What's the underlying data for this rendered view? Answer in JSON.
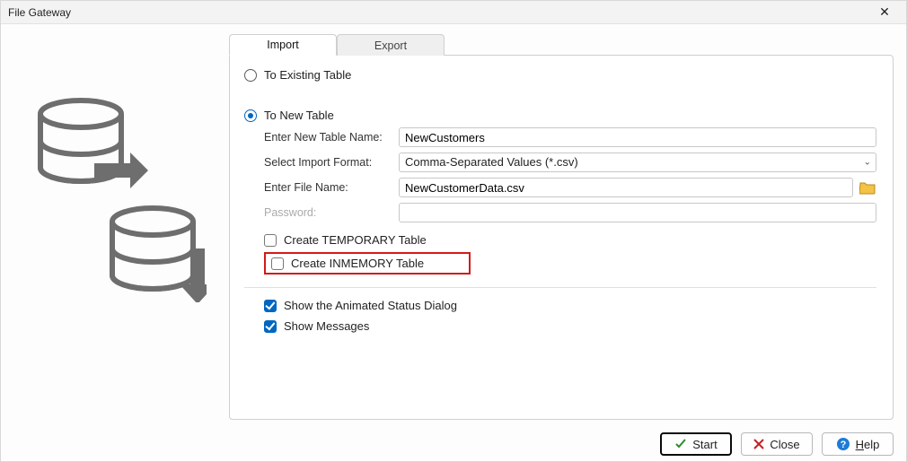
{
  "window": {
    "title": "File Gateway"
  },
  "tabs": {
    "import": "Import",
    "export": "Export"
  },
  "radios": {
    "existing": "To Existing Table",
    "new": "To New Table"
  },
  "labels": {
    "new_table_name": "Enter New Table Name:",
    "import_format": "Select Import Format:",
    "file_name": "Enter File Name:",
    "password": "Password:"
  },
  "fields": {
    "new_table_name": "NewCustomers",
    "format_selected": "Comma-Separated Values  (*.csv)",
    "file_name": "NewCustomerData.csv",
    "password": ""
  },
  "checkboxes": {
    "create_temp": "Create TEMPORARY Table",
    "create_inmem": "Create INMEMORY Table",
    "show_animated": "Show the Animated Status Dialog",
    "show_messages": "Show Messages"
  },
  "buttons": {
    "start": "Start",
    "close": "Close",
    "help_h": "H",
    "help_elp": "elp"
  }
}
